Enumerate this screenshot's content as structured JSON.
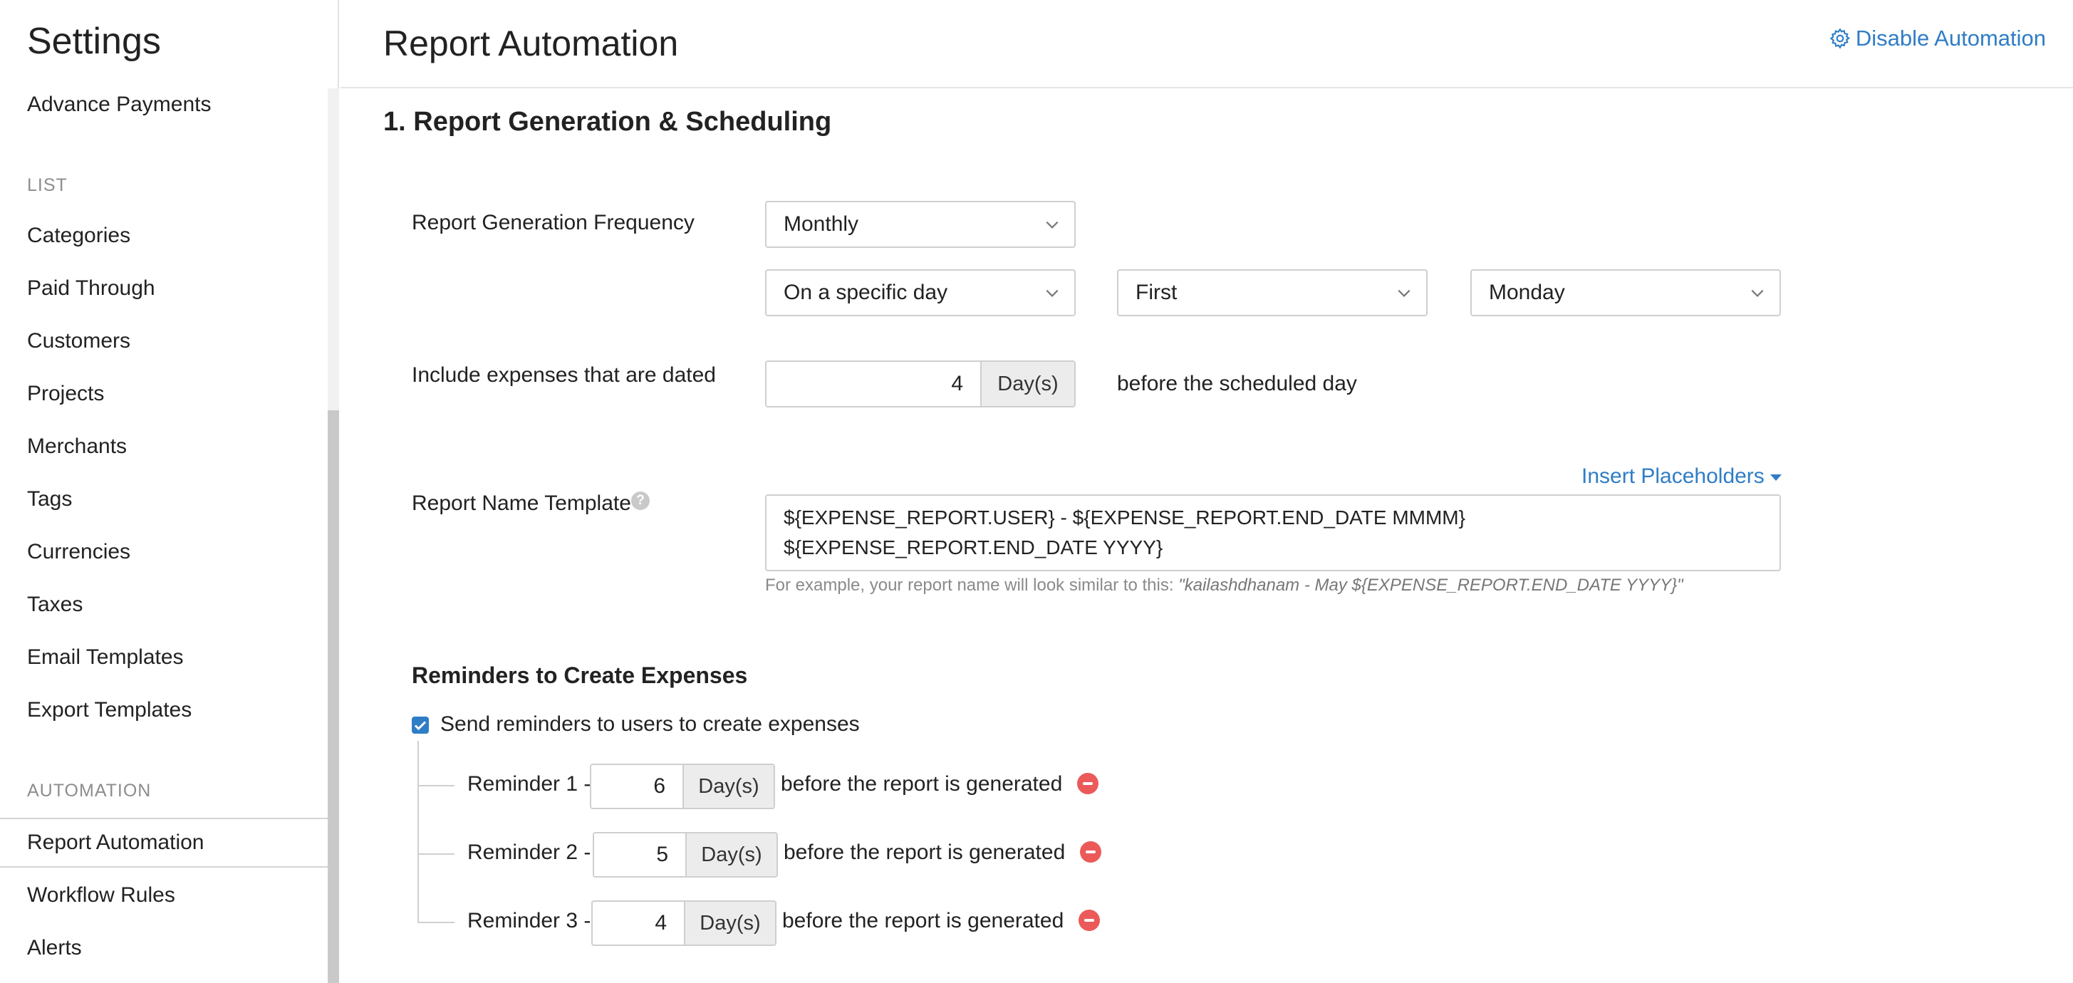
{
  "sidebar": {
    "title": "Settings",
    "items_top": [
      {
        "label": "Advance Payments"
      }
    ],
    "list_heading": "LIST",
    "list_items": [
      {
        "label": "Categories"
      },
      {
        "label": "Paid Through"
      },
      {
        "label": "Customers"
      },
      {
        "label": "Projects"
      },
      {
        "label": "Merchants"
      },
      {
        "label": "Tags"
      },
      {
        "label": "Currencies"
      },
      {
        "label": "Taxes"
      },
      {
        "label": "Email Templates"
      },
      {
        "label": "Export Templates"
      }
    ],
    "automation_heading": "AUTOMATION",
    "automation_items": [
      {
        "label": "Report Automation",
        "active": true
      },
      {
        "label": "Workflow Rules"
      },
      {
        "label": "Alerts"
      }
    ]
  },
  "header": {
    "title": "Report Automation",
    "disable_label": "Disable Automation"
  },
  "section": {
    "title": "1. Report Generation & Scheduling",
    "frequency_label": "Report Generation Frequency",
    "frequency_value": "Monthly",
    "day_mode_value": "On a specific day",
    "ordinal_value": "First",
    "weekday_value": "Monday",
    "include_label": "Include expenses that are dated",
    "include_days": "4",
    "days_unit": "Day(s)",
    "include_suffix": "before the scheduled day",
    "template_label": "Report Name Template",
    "help_icon": "?",
    "insert_placeholders_label": "Insert Placeholders",
    "template_line1": "${EXPENSE_REPORT.USER} - ${EXPENSE_REPORT.END_DATE MMMM}",
    "template_line2": "${EXPENSE_REPORT.END_DATE YYYY}",
    "example_prefix": "For example, your report name will look similar to this:",
    "example_value": "\"kailashdhanam - May ${EXPENSE_REPORT.END_DATE YYYY}\""
  },
  "reminders": {
    "title": "Reminders to Create Expenses",
    "checkbox_label": "Send reminders to users to create expenses",
    "checked": true,
    "suffix": "before the report is generated",
    "items": [
      {
        "label": "Reminder 1 -",
        "days": "6"
      },
      {
        "label": "Reminder 2 -",
        "days": "5"
      },
      {
        "label": "Reminder 3 -",
        "days": "4"
      }
    ]
  },
  "colors": {
    "accent": "#2f7dc6",
    "remove": "#ec5959"
  },
  "icons": {
    "settings": "gear-icon",
    "dropdown": "chevron-down-icon",
    "remove": "remove-circle-icon",
    "help": "help-circle-icon"
  }
}
